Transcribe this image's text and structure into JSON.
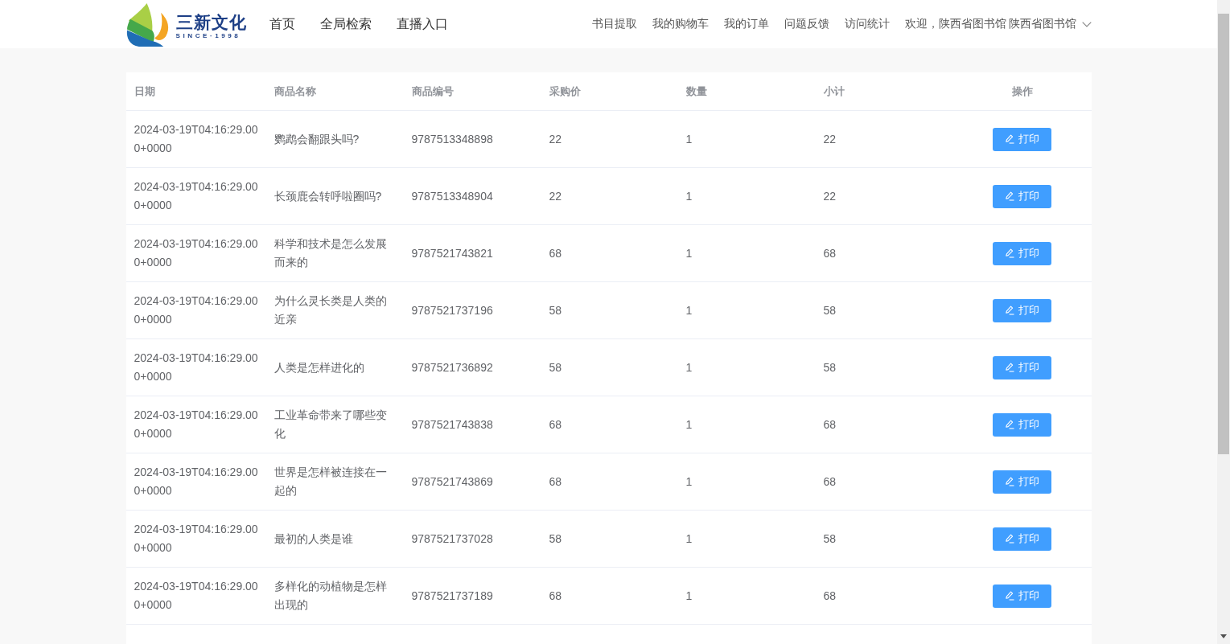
{
  "header": {
    "logo": {
      "wordmark": "三新文化",
      "tagline": "SINCE·1998"
    },
    "nav": [
      "首页",
      "全局检索",
      "直播入口"
    ],
    "links": [
      "书目提取",
      "我的购物车",
      "我的订单",
      "问题反馈",
      "访问统计"
    ],
    "user_menu": {
      "label": "欢迎，陕西省图书馆 陕西省图书馆"
    }
  },
  "table": {
    "columns": [
      "日期",
      "商品名称",
      "商品编号",
      "采购价",
      "数量",
      "小计",
      "操作"
    ],
    "rows": [
      {
        "date": "2024-03-19T04:16:29.000+0000",
        "name": "鹦鹉会翻跟头吗?",
        "code": "9787513348898",
        "price": "22",
        "quantity": "1",
        "subtotal": "22",
        "action": "打印"
      },
      {
        "date": "2024-03-19T04:16:29.000+0000",
        "name": "长颈鹿会转呼啦圈吗?",
        "code": "9787513348904",
        "price": "22",
        "quantity": "1",
        "subtotal": "22",
        "action": "打印"
      },
      {
        "date": "2024-03-19T04:16:29.000+0000",
        "name": "科学和技术是怎么发展而来的",
        "code": "9787521743821",
        "price": "68",
        "quantity": "1",
        "subtotal": "68",
        "action": "打印"
      },
      {
        "date": "2024-03-19T04:16:29.000+0000",
        "name": "为什么灵长类是人类的近亲",
        "code": "9787521737196",
        "price": "58",
        "quantity": "1",
        "subtotal": "58",
        "action": "打印"
      },
      {
        "date": "2024-03-19T04:16:29.000+0000",
        "name": "人类是怎样进化的",
        "code": "9787521736892",
        "price": "58",
        "quantity": "1",
        "subtotal": "58",
        "action": "打印"
      },
      {
        "date": "2024-03-19T04:16:29.000+0000",
        "name": "工业革命带来了哪些变化",
        "code": "9787521743838",
        "price": "68",
        "quantity": "1",
        "subtotal": "68",
        "action": "打印"
      },
      {
        "date": "2024-03-19T04:16:29.000+0000",
        "name": "世界是怎样被连接在一起的",
        "code": "9787521743869",
        "price": "68",
        "quantity": "1",
        "subtotal": "68",
        "action": "打印"
      },
      {
        "date": "2024-03-19T04:16:29.000+0000",
        "name": "最初的人类是谁",
        "code": "9787521737028",
        "price": "58",
        "quantity": "1",
        "subtotal": "58",
        "action": "打印"
      },
      {
        "date": "2024-03-19T04:16:29.000+0000",
        "name": "多样化的动植物是怎样出现的",
        "code": "9787521737189",
        "price": "68",
        "quantity": "1",
        "subtotal": "68",
        "action": "打印"
      }
    ]
  }
}
